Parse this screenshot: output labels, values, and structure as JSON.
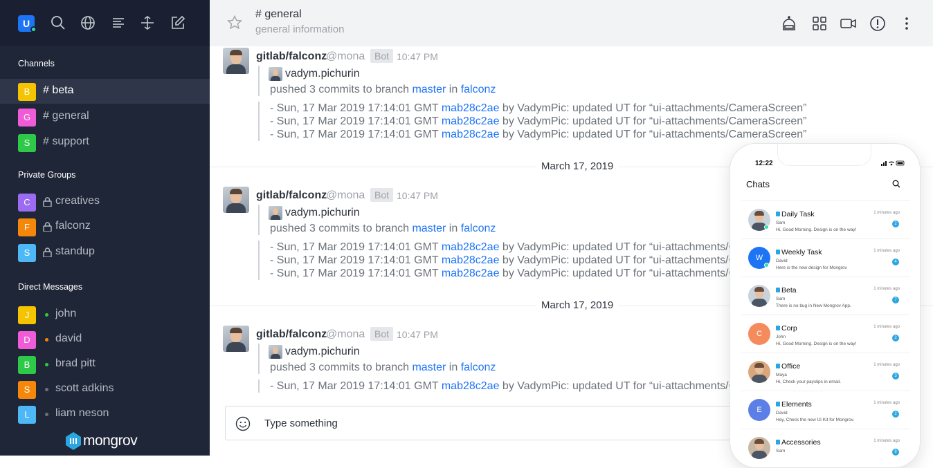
{
  "sidebar": {
    "user_initial": "U",
    "sections": {
      "channels": "Channels",
      "private": "Private Groups",
      "direct": "Direct Messages"
    },
    "channels": [
      {
        "initial": "B",
        "label": "# beta",
        "color": "#f5c400"
      },
      {
        "initial": "G",
        "label": "# general",
        "color": "#f05cd8"
      },
      {
        "initial": "S",
        "label": "# support",
        "color": "#2ec948"
      }
    ],
    "private": [
      {
        "initial": "C",
        "label": "creatives",
        "color": "#9b6bf2"
      },
      {
        "initial": "F",
        "label": "falconz",
        "color": "#f5870a"
      },
      {
        "initial": "S",
        "label": "standup",
        "color": "#4db8f5"
      }
    ],
    "direct": [
      {
        "initial": "J",
        "label": "john",
        "color": "#f5c400",
        "status": "#2ec948"
      },
      {
        "initial": "D",
        "label": "david",
        "color": "#f05cd8",
        "status": "#f5870a"
      },
      {
        "initial": "B",
        "label": "brad pitt",
        "color": "#2ec948",
        "status": "#2ec948"
      },
      {
        "initial": "S",
        "label": "scott adkins",
        "color": "#f5870a",
        "status": "#6c727a"
      },
      {
        "initial": "L",
        "label": "liam neson",
        "color": "#4db8f5",
        "status": "#6c727a"
      }
    ],
    "logo": "mongrov"
  },
  "header": {
    "channel": "# general",
    "subtitle": "general information"
  },
  "messages": [
    {
      "author": "gitlab/falconz",
      "handle": "@mona",
      "bot": "Bot",
      "time": "10:47 PM",
      "attach_author": "vadym.pichurin",
      "pushed_prefix": "pushed 3 commits to branch ",
      "branch": "master",
      "in": " in ",
      "repo": "falconz",
      "commits": [
        {
          "pre": "- Sun, 17 Mar 2019 17:14:01 GMT ",
          "hash": "mab28c2ae",
          "post": " by VadymPic: updated UT for “ui-attachments/CameraScreen”"
        },
        {
          "pre": "- Sun, 17 Mar 2019 17:14:01 GMT ",
          "hash": "mab28c2ae",
          "post": " by VadymPic: updated UT for “ui-attachments/CameraScreen”"
        },
        {
          "pre": "- Sun, 17 Mar 2019 17:14:01 GMT ",
          "hash": "mab28c2ae",
          "post": " by VadymPic: updated UT for “ui-attachments/CameraScreen”"
        }
      ]
    },
    {
      "author": "gitlab/falconz",
      "handle": "@mona",
      "bot": "Bot",
      "time": "10:47 PM",
      "attach_author": "vadym.pichurin",
      "pushed_prefix": "pushed 3 commits to branch ",
      "branch": "master",
      "in": " in ",
      "repo": "falconz",
      "commits": [
        {
          "pre": "- Sun, 17 Mar 2019 17:14:01 GMT ",
          "hash": "mab28c2ae",
          "post": " by VadymPic: updated UT for “ui-attachments/CameraS"
        },
        {
          "pre": "- Sun, 17 Mar 2019 17:14:01 GMT ",
          "hash": "mab28c2ae",
          "post": " by VadymPic: updated UT for “ui-attachments/CameraS"
        },
        {
          "pre": "- Sun, 17 Mar 2019 17:14:01 GMT ",
          "hash": "mab28c2ae",
          "post": " by VadymPic: updated UT for “ui-attachments/CameraS"
        }
      ]
    },
    {
      "author": "gitlab/falconz",
      "handle": "@mona",
      "bot": "Bot",
      "time": "10:47 PM",
      "attach_author": "vadym.pichurin",
      "pushed_prefix": "pushed 3 commits to branch ",
      "branch": "master",
      "in": " in ",
      "repo": "falconz",
      "commits": [
        {
          "pre": "- Sun, 17 Mar 2019 17:14:01 GMT ",
          "hash": "mab28c2ae",
          "post": " by VadymPic: updated UT for “ui-attachments/CameraS"
        }
      ]
    }
  ],
  "dividers": [
    "March 17, 2019",
    "March 17, 2019"
  ],
  "composer": {
    "placeholder": "Type something"
  },
  "phone": {
    "time": "12:22",
    "title": "Chats",
    "chats": [
      {
        "name": "Daily Task",
        "who": "Sam",
        "msg": "Hi, Good Morning. Design is on the way!",
        "ts": "1 minutes ago",
        "badge": "2",
        "initial": "",
        "color": "#c9d3dc",
        "photo": true
      },
      {
        "name": "Weekly Task",
        "who": "David",
        "msg": "Here is the new design for Mongrov",
        "ts": "1 minutes ago",
        "badge": "4",
        "initial": "W",
        "color": "#1d74f5",
        "photo": false
      },
      {
        "name": "Beta",
        "who": "Sam",
        "msg": "There is no bug in New Mongrov App.",
        "ts": "1 minutes ago",
        "badge": "7",
        "initial": "",
        "color": "#c9d3dc",
        "photo": true
      },
      {
        "name": "Corp",
        "who": "John",
        "msg": "Hi, Good Morning. Design is on the way!",
        "ts": "1 minutes ago",
        "badge": "2",
        "initial": "C",
        "color": "#f58a5c",
        "photo": false
      },
      {
        "name": "Office",
        "who": "Maya",
        "msg": "Hi, Check your payslips in email.",
        "ts": "1 minutes ago",
        "badge": "3",
        "initial": "",
        "color": "#d9a77a",
        "photo": true
      },
      {
        "name": "Elements",
        "who": "David",
        "msg": "Hey, Check the new UI Kit for Mongrov.",
        "ts": "1 minutes ago",
        "badge": "2",
        "initial": "E",
        "color": "#5b7fe6",
        "photo": false
      },
      {
        "name": "Accessories",
        "who": "Sam",
        "msg": "",
        "ts": "1 minutes ago",
        "badge": "9",
        "initial": "",
        "color": "#c9b7a6",
        "photo": true
      }
    ]
  }
}
